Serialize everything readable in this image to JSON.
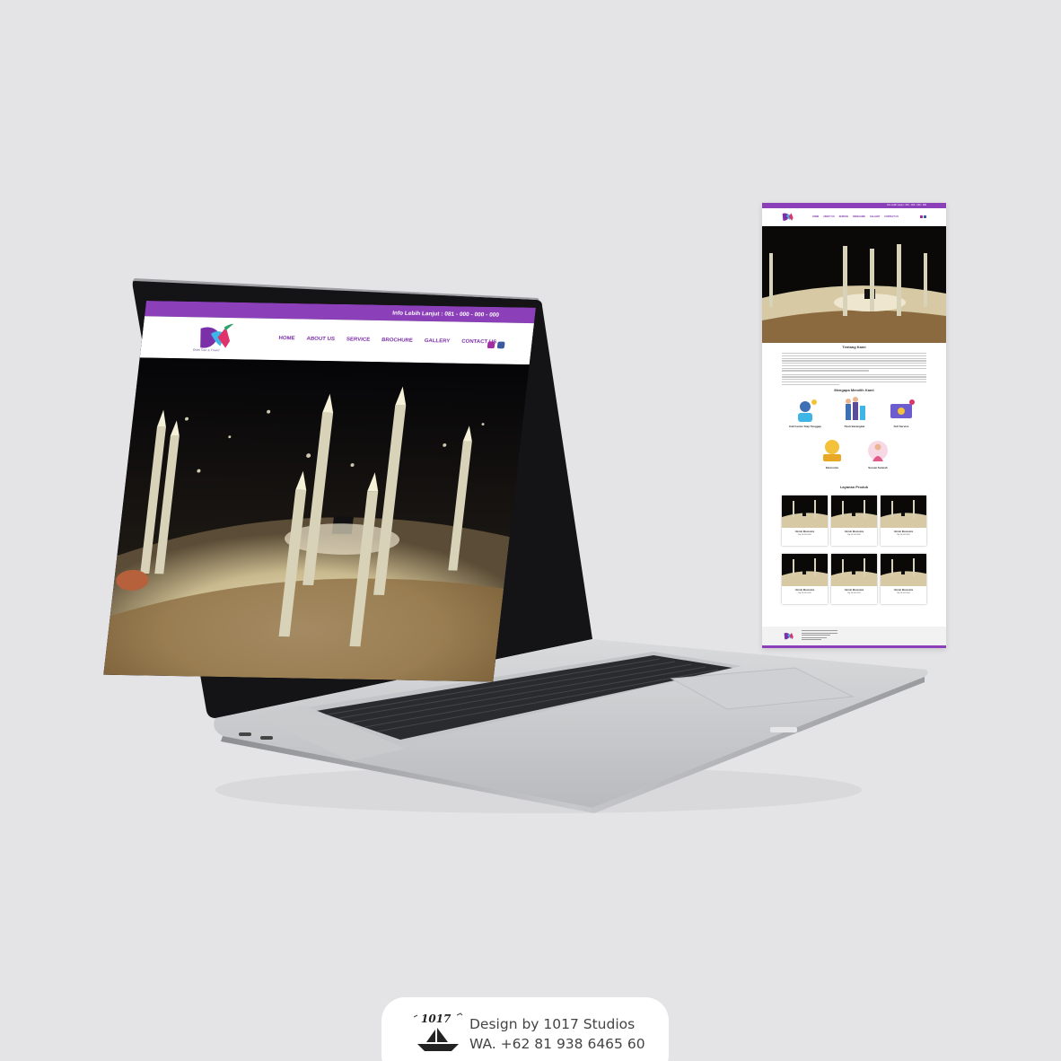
{
  "laptop_site": {
    "topbar_info": "Info Lebih Lanjut : 081 - 000 - 000 - 000",
    "logo_tagline": "Dvlm Tour & Travel",
    "menu": [
      "HOME",
      "ABOUT US",
      "SERVICE",
      "BROCHURE",
      "GALLERY",
      "CONTACT US"
    ],
    "social_icons": [
      "instagram-icon",
      "facebook-icon"
    ]
  },
  "page_preview": {
    "topbar_info": "Info Lebih Lanjut : 081 - 000 - 000 - 000",
    "menu": [
      "HOME",
      "ABOUT US",
      "SERVICE",
      "BROCHURE",
      "GALLERY",
      "CONTACT US"
    ],
    "about_title": "Tentang Kami",
    "why_title": "Mengapa Memilih Kami",
    "features": [
      {
        "label": "Call Center Siap Tanggap"
      },
      {
        "label": "Pasti Berangkat"
      },
      {
        "label": "Full Service"
      },
      {
        "label": "Ekonomis"
      },
      {
        "label": "Sesuai Sunnah"
      }
    ],
    "products_title": "Layanan Produk",
    "products": [
      {
        "name": "Umroh Ekonomis",
        "price": "Rp.20.000.000"
      },
      {
        "name": "Umroh Ekonomis",
        "price": "Rp.20.000.000"
      },
      {
        "name": "Umroh Ekonomis",
        "price": "Rp.20.000.000"
      },
      {
        "name": "Umroh Ekonomis",
        "price": "Rp.20.000.000"
      },
      {
        "name": "Umroh Ekonomis",
        "price": "Rp.20.000.000"
      },
      {
        "name": "Umroh Ekonomis",
        "price": "Rp.20.000.000"
      }
    ]
  },
  "credit": {
    "line1": "Design by 1017 Studios",
    "line2": "WA. +62 81 938 6465 60",
    "logo_text": "1017"
  },
  "colors": {
    "brand_purple": "#8b3fb8",
    "background": "#e4e4e6"
  }
}
